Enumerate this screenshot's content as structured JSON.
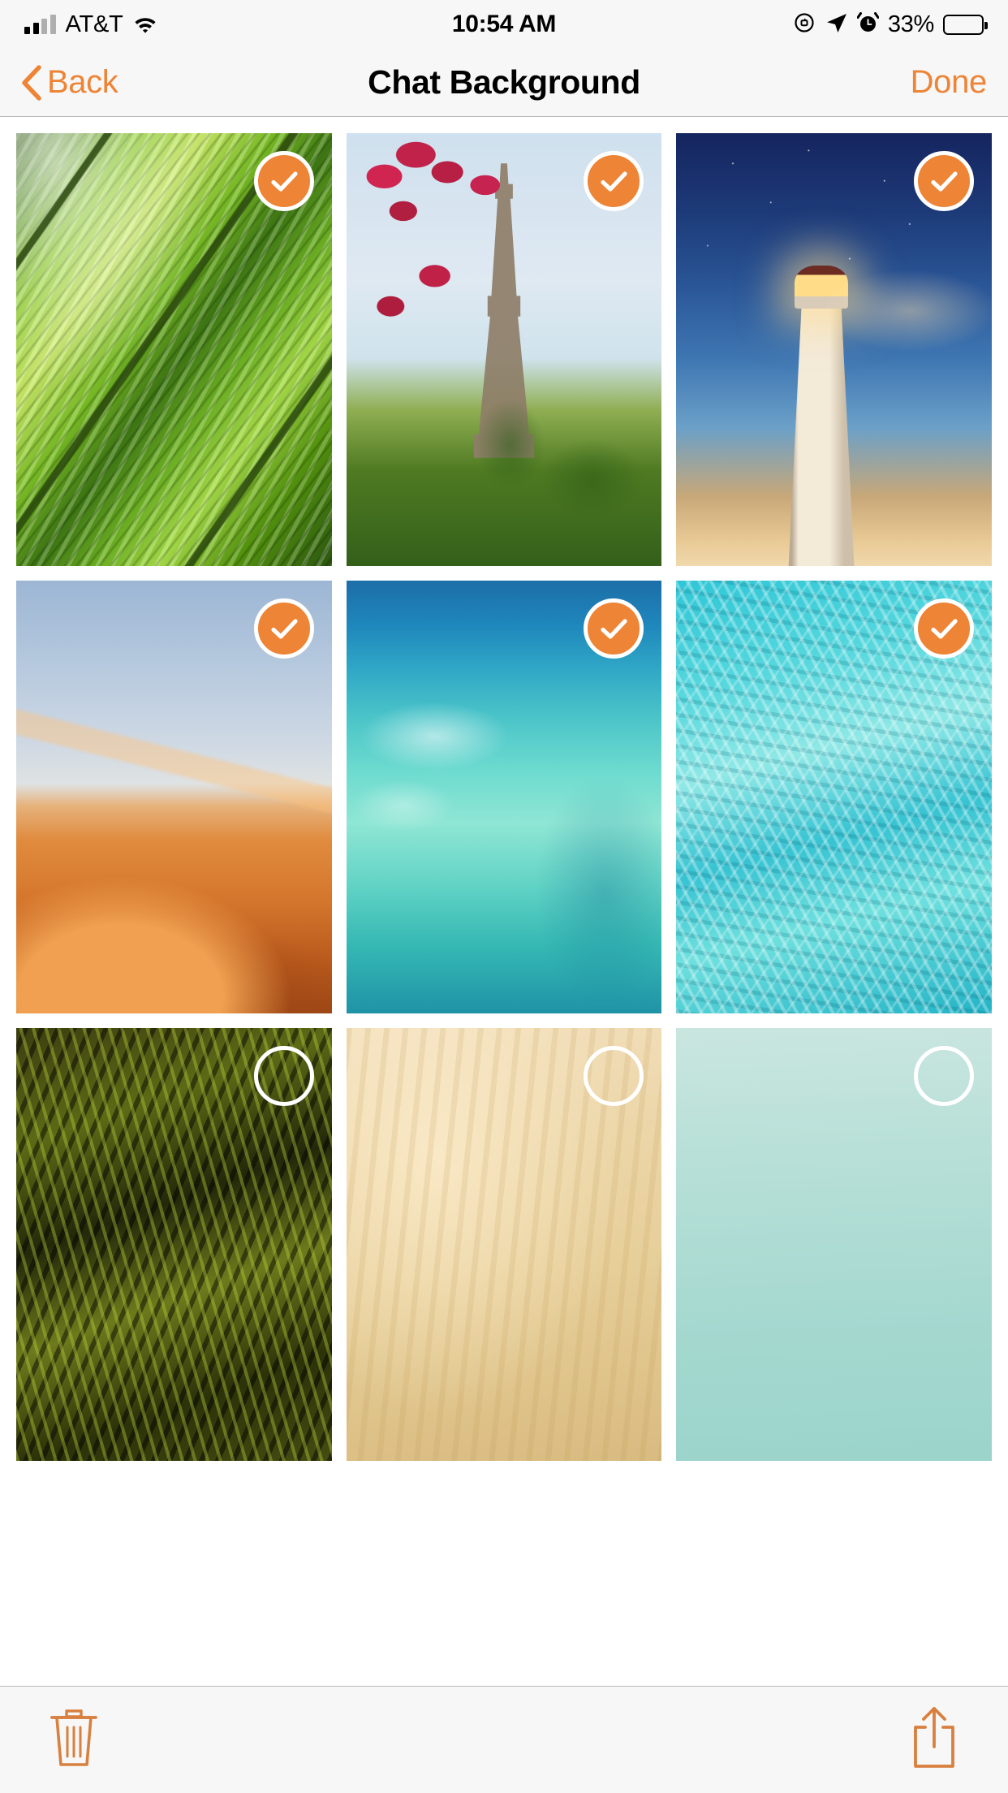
{
  "status_bar": {
    "carrier": "AT&T",
    "time": "10:54 AM",
    "battery_percent": "33%",
    "icons": [
      "signal-bars-icon",
      "wifi-icon",
      "orientation-lock-icon",
      "location-arrow-icon",
      "alarm-clock-icon",
      "battery-icon"
    ]
  },
  "nav_bar": {
    "back_label": "Back",
    "title": "Chat Background",
    "done_label": "Done"
  },
  "colors": {
    "accent": "#ED8436",
    "nav_background": "#f7f7f7",
    "nav_title": "#000000",
    "page_background": "#ffffff",
    "separator": "#b9b9bb",
    "badge_ring": "#ffffff"
  },
  "grid": {
    "columns": 3,
    "items": [
      {
        "id": "bg-1",
        "name": "green-leaf",
        "label": "Green Leaf",
        "selected": true,
        "art_class": "art-leaf",
        "badge_icon": "check-icon"
      },
      {
        "id": "bg-2",
        "name": "eiffel-tower",
        "label": "Eiffel Tower",
        "selected": true,
        "art_class": "art-eiffel",
        "badge_icon": "check-icon"
      },
      {
        "id": "bg-3",
        "name": "lighthouse-night",
        "label": "Lighthouse",
        "selected": true,
        "art_class": "art-lighthouse",
        "badge_icon": "check-icon"
      },
      {
        "id": "bg-4",
        "name": "sand-dune",
        "label": "Sand Dune",
        "selected": true,
        "art_class": "art-dune",
        "badge_icon": "check-icon"
      },
      {
        "id": "bg-5",
        "name": "tropical-atoll",
        "label": "Tropical Atoll",
        "selected": true,
        "art_class": "art-atoll",
        "badge_icon": "check-icon"
      },
      {
        "id": "bg-6",
        "name": "turquoise-water",
        "label": "Turquoise Water",
        "selected": true,
        "art_class": "art-water",
        "badge_icon": "check-icon"
      },
      {
        "id": "bg-7",
        "name": "dark-foliage",
        "label": "Dark Foliage",
        "selected": false,
        "art_class": "art-foliage",
        "badge_icon": "empty-circle-icon"
      },
      {
        "id": "bg-8",
        "name": "beige-parchment",
        "label": "Beige Parchment",
        "selected": false,
        "art_class": "art-parchment",
        "badge_icon": "empty-circle-icon"
      },
      {
        "id": "bg-9",
        "name": "mint-gradient",
        "label": "Mint Gradient",
        "selected": false,
        "art_class": "art-mint",
        "badge_icon": "empty-circle-icon"
      }
    ]
  },
  "toolbar": {
    "delete_icon": "trash-icon",
    "share_icon": "share-upload-icon"
  }
}
